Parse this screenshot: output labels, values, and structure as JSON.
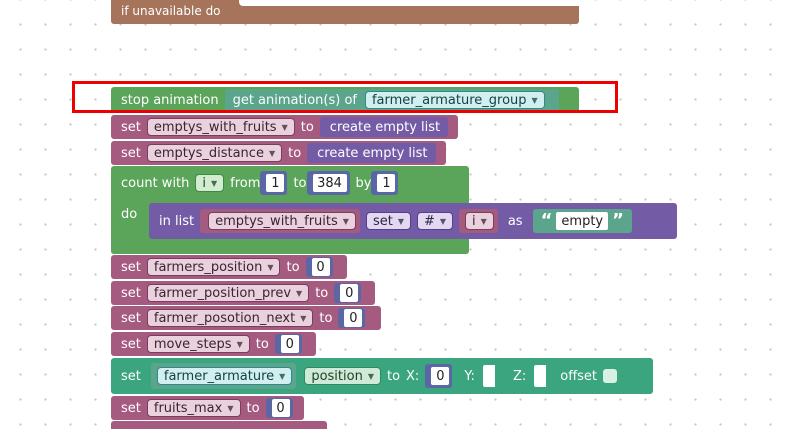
{
  "blocks": {
    "top_partial": {
      "label": "if unavailable do"
    },
    "stop_anim": {
      "label": "stop animation",
      "get_label": "get animation(s) of",
      "var": "farmer_armature_group"
    },
    "set_fruits": {
      "set": "set",
      "var": "emptys_with_fruits",
      "to": "to",
      "value": "create empty list"
    },
    "set_distance": {
      "set": "set",
      "var": "emptys_distance",
      "to": "to",
      "value": "create empty list"
    },
    "count": {
      "label": "count with",
      "var": "i",
      "from_label": "from",
      "from": "1",
      "to_label": "to",
      "to": "384",
      "by_label": "by",
      "by": "1",
      "do_label": "do",
      "inner": {
        "in_list": "in list",
        "list_var": "emptys_with_fruits",
        "mode": "set",
        "where": "#",
        "index_var": "i",
        "as": "as",
        "string": "empty"
      }
    },
    "set_pos": {
      "set": "set",
      "var": "farmers_position",
      "to": "to",
      "value": "0"
    },
    "set_prev": {
      "set": "set",
      "var": "farmer_position_prev",
      "to": "to",
      "value": "0"
    },
    "set_next": {
      "set": "set",
      "var": "farmer_posotion_next",
      "to": "to",
      "value": "0"
    },
    "set_steps": {
      "set": "set",
      "var": "move_steps",
      "to": "to",
      "value": "0"
    },
    "set_armature": {
      "set": "set",
      "var": "farmer_armature",
      "prop": "position",
      "to": "to",
      "x_label": "X:",
      "x": "0",
      "y_label": "Y:",
      "z_label": "Z:",
      "offset_label": "offset"
    },
    "set_fruits_max": {
      "set": "set",
      "var": "fruits_max",
      "to": "to",
      "value": "0"
    }
  },
  "colors": {
    "variable": "#a55b80",
    "list": "#745ba5",
    "loop": "#5ba55b",
    "object": "#3aa57f",
    "math": "#5b67a5",
    "highlight": "#ee0000"
  }
}
